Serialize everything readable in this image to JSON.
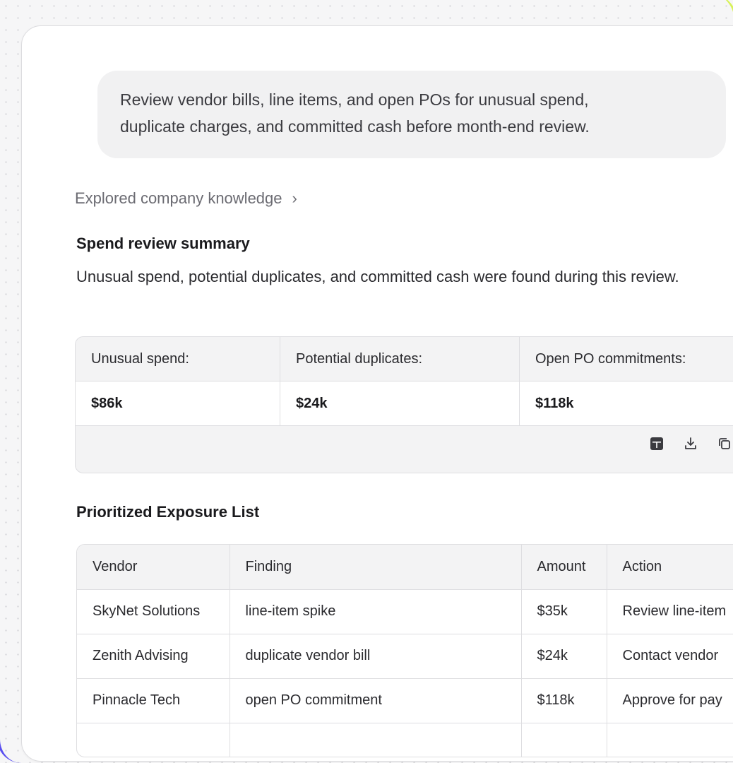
{
  "prompt": {
    "line1": "Review vendor bills, line items, and open POs for unusual spend,",
    "line2": "duplicate charges, and committed cash before month-end review."
  },
  "explored": {
    "label": "Explored company knowledge",
    "chevron": "›"
  },
  "summary": {
    "title": "Spend review summary",
    "text": "Unusual spend, potential duplicates, and committed cash were found during this review.",
    "metrics": [
      {
        "label": "Unusual spend:",
        "value": "$86k"
      },
      {
        "label": "Potential duplicates:",
        "value": "$24k"
      },
      {
        "label": "Open PO commitments:",
        "value": "$118k"
      }
    ],
    "toolbar_icons": [
      "table-icon",
      "download-icon",
      "copy-icon"
    ]
  },
  "exposure": {
    "title": "Prioritized Exposure List",
    "columns": [
      "Vendor",
      "Finding",
      "Amount",
      "Action"
    ],
    "rows": [
      {
        "vendor": "SkyNet Solutions",
        "finding": "line-item spike",
        "amount": "$35k",
        "action": "Review line-item"
      },
      {
        "vendor": "Zenith Advising",
        "finding": "duplicate vendor bill",
        "amount": "$24k",
        "action": "Contact vendor"
      },
      {
        "vendor": "Pinnacle Tech",
        "finding": "open PO commitment",
        "amount": "$118k",
        "action": "Approve for pay"
      },
      {
        "vendor": "",
        "finding": "",
        "amount": "",
        "action": ""
      }
    ]
  }
}
